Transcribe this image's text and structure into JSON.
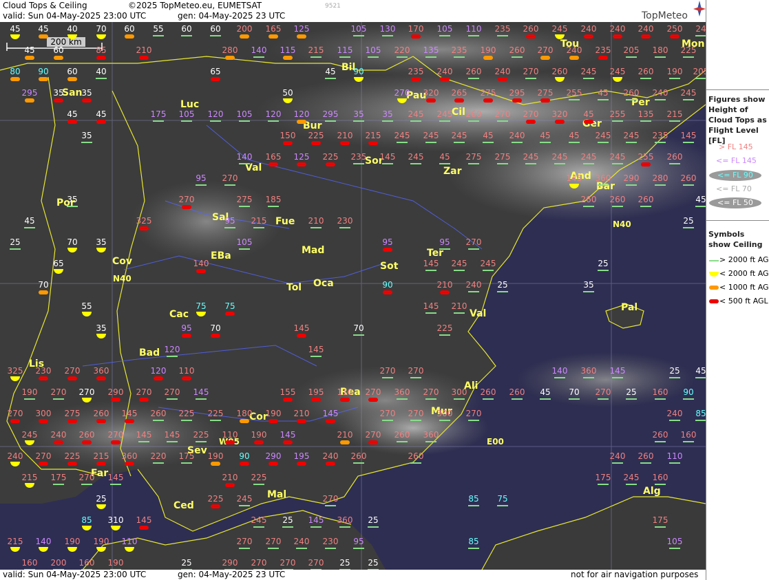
{
  "header": {
    "title": "Cloud Tops & Ceiling",
    "copyright": "©2025 TopMeteo.eu, EUMETSAT",
    "valid": "valid:  Sun  04-May-2025  23:00 UTC",
    "gen": "gen: 04-May-2025 23 UTC",
    "code": "9521",
    "brand": "TopMeteo"
  },
  "footer": {
    "valid": "valid:  Sun  04-May-2025  23:00 UTC",
    "gen": "gen: 04-May-2025 23 UTC",
    "disclaimer": "not for air navigation purposes"
  },
  "legend": {
    "title1": "Figures show Height of Cloud Tops as Flight Level  [FL]",
    "items": [
      {
        "label": "> FL 145",
        "color": "#f08080"
      },
      {
        "label": "<= FL 145",
        "color": "#cc88ff"
      },
      {
        "label": "<= FL 90",
        "color": "#66ffff"
      },
      {
        "label": "<= FL 70",
        "color": "#aaaaaa"
      },
      {
        "label": "<= FL 50",
        "color": "#ffffff"
      }
    ],
    "title2": "Symbols show Ceiling",
    "symbols": [
      {
        "label": "> 2000 ft AGL",
        "color": "#88dd88"
      },
      {
        "label": "< 2000 ft AGL",
        "color": "#ffff00"
      },
      {
        "label": "< 1000 ft AGL",
        "color": "#ff9900"
      },
      {
        "label": "< 500 ft AGL",
        "color": "#ee0000"
      }
    ]
  },
  "map": {
    "scale_label": "200 km",
    "lat_label": "N40",
    "lon_labels": [
      "W05",
      "E00"
    ],
    "cities": [
      "Tou",
      "Mon",
      "Bil",
      "Pau",
      "Per",
      "San",
      "Luc",
      "Cil",
      "Bur",
      "Ger",
      "Sor",
      "Val",
      "Zar",
      "Por",
      "Sal",
      "Fue",
      "And",
      "Bar",
      "EBa",
      "Cov",
      "Mad",
      "Sot",
      "Ter",
      "Oca",
      "Tol",
      "Cac",
      "Bad",
      "Lis",
      "Rea",
      "Cor",
      "Mur",
      "Ali",
      "Sev",
      "Far",
      "Ced",
      "Mal",
      "Alg",
      "Pal",
      "Val"
    ],
    "values": [
      "45",
      "40",
      "70",
      "60",
      "55",
      "200",
      "165",
      "125",
      "105",
      "130",
      "170",
      "110",
      "235",
      "260",
      "245",
      "240",
      "250",
      "24",
      "45",
      "80",
      "60",
      "85",
      "210",
      "280",
      "140",
      "115",
      "215",
      "220",
      "135",
      "190",
      "270",
      "205",
      "180",
      "225",
      "90",
      "65",
      "50",
      "35",
      "100",
      "120",
      "295",
      "320",
      "265",
      "275",
      "255",
      "45",
      "95",
      "175",
      "150",
      "325",
      "330",
      "185",
      "230",
      "25",
      "145",
      "310",
      "300",
      "290",
      "360",
      "155",
      "195",
      "160",
      "175",
      "85",
      "75"
    ]
  }
}
